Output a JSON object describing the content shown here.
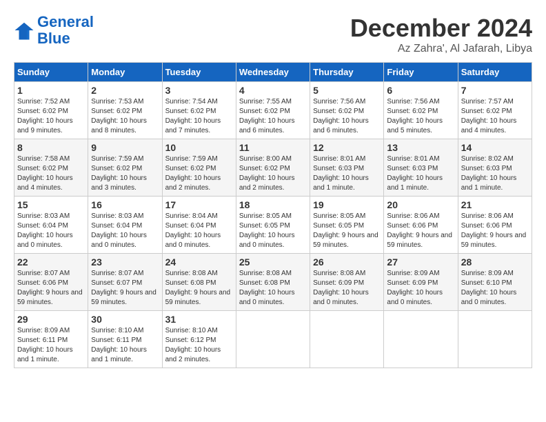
{
  "header": {
    "logo_line1": "General",
    "logo_line2": "Blue",
    "month": "December 2024",
    "location": "Az Zahra', Al Jafarah, Libya"
  },
  "weekdays": [
    "Sunday",
    "Monday",
    "Tuesday",
    "Wednesday",
    "Thursday",
    "Friday",
    "Saturday"
  ],
  "weeks": [
    [
      {
        "day": "1",
        "sunrise": "Sunrise: 7:52 AM",
        "sunset": "Sunset: 6:02 PM",
        "daylight": "Daylight: 10 hours and 9 minutes."
      },
      {
        "day": "2",
        "sunrise": "Sunrise: 7:53 AM",
        "sunset": "Sunset: 6:02 PM",
        "daylight": "Daylight: 10 hours and 8 minutes."
      },
      {
        "day": "3",
        "sunrise": "Sunrise: 7:54 AM",
        "sunset": "Sunset: 6:02 PM",
        "daylight": "Daylight: 10 hours and 7 minutes."
      },
      {
        "day": "4",
        "sunrise": "Sunrise: 7:55 AM",
        "sunset": "Sunset: 6:02 PM",
        "daylight": "Daylight: 10 hours and 6 minutes."
      },
      {
        "day": "5",
        "sunrise": "Sunrise: 7:56 AM",
        "sunset": "Sunset: 6:02 PM",
        "daylight": "Daylight: 10 hours and 6 minutes."
      },
      {
        "day": "6",
        "sunrise": "Sunrise: 7:56 AM",
        "sunset": "Sunset: 6:02 PM",
        "daylight": "Daylight: 10 hours and 5 minutes."
      },
      {
        "day": "7",
        "sunrise": "Sunrise: 7:57 AM",
        "sunset": "Sunset: 6:02 PM",
        "daylight": "Daylight: 10 hours and 4 minutes."
      }
    ],
    [
      {
        "day": "8",
        "sunrise": "Sunrise: 7:58 AM",
        "sunset": "Sunset: 6:02 PM",
        "daylight": "Daylight: 10 hours and 4 minutes."
      },
      {
        "day": "9",
        "sunrise": "Sunrise: 7:59 AM",
        "sunset": "Sunset: 6:02 PM",
        "daylight": "Daylight: 10 hours and 3 minutes."
      },
      {
        "day": "10",
        "sunrise": "Sunrise: 7:59 AM",
        "sunset": "Sunset: 6:02 PM",
        "daylight": "Daylight: 10 hours and 2 minutes."
      },
      {
        "day": "11",
        "sunrise": "Sunrise: 8:00 AM",
        "sunset": "Sunset: 6:02 PM",
        "daylight": "Daylight: 10 hours and 2 minutes."
      },
      {
        "day": "12",
        "sunrise": "Sunrise: 8:01 AM",
        "sunset": "Sunset: 6:03 PM",
        "daylight": "Daylight: 10 hours and 1 minute."
      },
      {
        "day": "13",
        "sunrise": "Sunrise: 8:01 AM",
        "sunset": "Sunset: 6:03 PM",
        "daylight": "Daylight: 10 hours and 1 minute."
      },
      {
        "day": "14",
        "sunrise": "Sunrise: 8:02 AM",
        "sunset": "Sunset: 6:03 PM",
        "daylight": "Daylight: 10 hours and 1 minute."
      }
    ],
    [
      {
        "day": "15",
        "sunrise": "Sunrise: 8:03 AM",
        "sunset": "Sunset: 6:04 PM",
        "daylight": "Daylight: 10 hours and 0 minutes."
      },
      {
        "day": "16",
        "sunrise": "Sunrise: 8:03 AM",
        "sunset": "Sunset: 6:04 PM",
        "daylight": "Daylight: 10 hours and 0 minutes."
      },
      {
        "day": "17",
        "sunrise": "Sunrise: 8:04 AM",
        "sunset": "Sunset: 6:04 PM",
        "daylight": "Daylight: 10 hours and 0 minutes."
      },
      {
        "day": "18",
        "sunrise": "Sunrise: 8:05 AM",
        "sunset": "Sunset: 6:05 PM",
        "daylight": "Daylight: 10 hours and 0 minutes."
      },
      {
        "day": "19",
        "sunrise": "Sunrise: 8:05 AM",
        "sunset": "Sunset: 6:05 PM",
        "daylight": "Daylight: 9 hours and 59 minutes."
      },
      {
        "day": "20",
        "sunrise": "Sunrise: 8:06 AM",
        "sunset": "Sunset: 6:06 PM",
        "daylight": "Daylight: 9 hours and 59 minutes."
      },
      {
        "day": "21",
        "sunrise": "Sunrise: 8:06 AM",
        "sunset": "Sunset: 6:06 PM",
        "daylight": "Daylight: 9 hours and 59 minutes."
      }
    ],
    [
      {
        "day": "22",
        "sunrise": "Sunrise: 8:07 AM",
        "sunset": "Sunset: 6:06 PM",
        "daylight": "Daylight: 9 hours and 59 minutes."
      },
      {
        "day": "23",
        "sunrise": "Sunrise: 8:07 AM",
        "sunset": "Sunset: 6:07 PM",
        "daylight": "Daylight: 9 hours and 59 minutes."
      },
      {
        "day": "24",
        "sunrise": "Sunrise: 8:08 AM",
        "sunset": "Sunset: 6:08 PM",
        "daylight": "Daylight: 9 hours and 59 minutes."
      },
      {
        "day": "25",
        "sunrise": "Sunrise: 8:08 AM",
        "sunset": "Sunset: 6:08 PM",
        "daylight": "Daylight: 10 hours and 0 minutes."
      },
      {
        "day": "26",
        "sunrise": "Sunrise: 8:08 AM",
        "sunset": "Sunset: 6:09 PM",
        "daylight": "Daylight: 10 hours and 0 minutes."
      },
      {
        "day": "27",
        "sunrise": "Sunrise: 8:09 AM",
        "sunset": "Sunset: 6:09 PM",
        "daylight": "Daylight: 10 hours and 0 minutes."
      },
      {
        "day": "28",
        "sunrise": "Sunrise: 8:09 AM",
        "sunset": "Sunset: 6:10 PM",
        "daylight": "Daylight: 10 hours and 0 minutes."
      }
    ],
    [
      {
        "day": "29",
        "sunrise": "Sunrise: 8:09 AM",
        "sunset": "Sunset: 6:11 PM",
        "daylight": "Daylight: 10 hours and 1 minute."
      },
      {
        "day": "30",
        "sunrise": "Sunrise: 8:10 AM",
        "sunset": "Sunset: 6:11 PM",
        "daylight": "Daylight: 10 hours and 1 minute."
      },
      {
        "day": "31",
        "sunrise": "Sunrise: 8:10 AM",
        "sunset": "Sunset: 6:12 PM",
        "daylight": "Daylight: 10 hours and 2 minutes."
      },
      null,
      null,
      null,
      null
    ]
  ]
}
